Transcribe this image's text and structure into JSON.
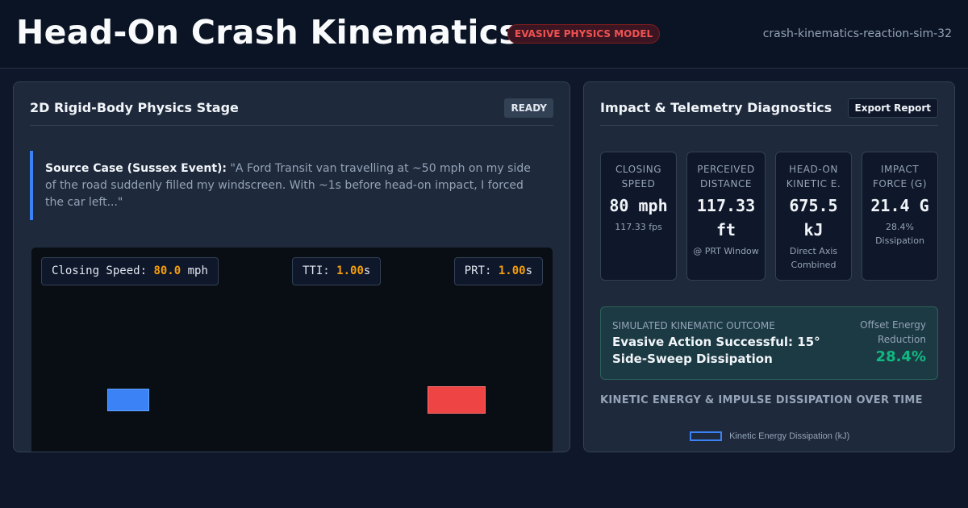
{
  "header": {
    "title": "Head-On Crash Kinematics",
    "badge": "EVASIVE PHYSICS MODEL",
    "sim_id": "crash-kinematics-reaction-sim-32"
  },
  "left_panel": {
    "title": "2D Rigid-Body Physics Stage",
    "status": "READY",
    "source_label": "Source Case (Sussex Event):",
    "source_quote": "\"A Ford Transit van travelling at ~50 mph on my side of the road suddenly filled my windscreen. With ~1s before head-on impact, I forced the car left...\"",
    "hud": {
      "speed_label": "Closing Speed:",
      "speed_value": "80.0",
      "speed_unit": "mph",
      "tti_label": "TTI:",
      "tti_value": "1.00",
      "tti_unit": "s",
      "prt_label": "PRT:",
      "prt_value": "1.00",
      "prt_unit": "s"
    }
  },
  "right_panel": {
    "title": "Impact & Telemetry Diagnostics",
    "export_label": "Export Report",
    "stats": [
      {
        "label": "CLOSING SPEED",
        "value": "80 mph",
        "sub": "117.33 fps"
      },
      {
        "label": "PERCEIVED DISTANCE",
        "value": "117.33 ft",
        "sub": "@ PRT Window"
      },
      {
        "label": "HEAD-ON KINETIC E.",
        "value": "675.5 kJ",
        "sub": "Direct Axis Combined"
      },
      {
        "label": "IMPACT FORCE (G)",
        "value": "21.4 G",
        "sub": "28.4% Dissipation"
      }
    ],
    "outcome": {
      "label": "SIMULATED KINEMATIC OUTCOME",
      "text": "Evasive Action Successful: 15° Side-Sweep Dissipation",
      "right_label": "Offset Energy Reduction",
      "percent": "28.4%"
    },
    "chart_title": "KINETIC ENERGY & IMPULSE DISSIPATION OVER TIME",
    "legend_label": "Kinetic Energy Dissipation (kJ)"
  },
  "colors": {
    "accent_blue": "#3b82f6",
    "accent_red": "#ef4444",
    "warning": "#f59e0b",
    "success": "#10b981"
  }
}
